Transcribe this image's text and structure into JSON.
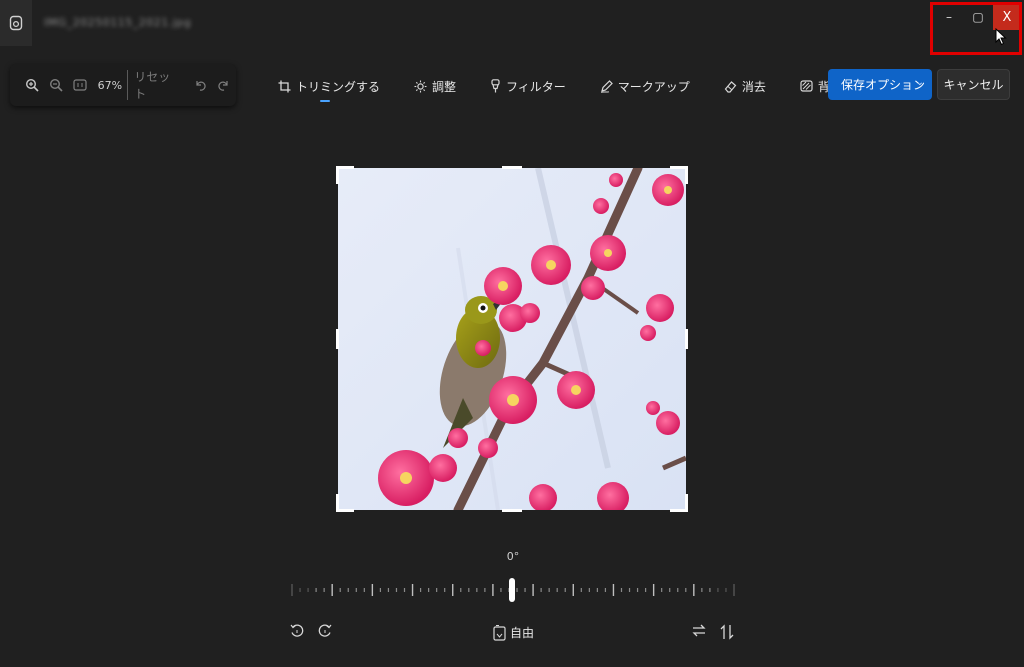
{
  "titlebar": {
    "filename": "IMG_20250115_2021.jpg",
    "minimize": "–",
    "maximize": "▢",
    "close": "X"
  },
  "zoom": {
    "value": "67%",
    "reset_label": "リセット"
  },
  "tabs": [
    {
      "label": "トリミングする",
      "icon": "crop-icon",
      "active": true
    },
    {
      "label": "調整",
      "icon": "brightness-icon",
      "active": false
    },
    {
      "label": "フィルター",
      "icon": "filter-icon",
      "active": false
    },
    {
      "label": "マークアップ",
      "icon": "markup-icon",
      "active": false
    },
    {
      "label": "消去",
      "icon": "erase-icon",
      "active": false
    },
    {
      "label": "背景",
      "icon": "background-icon",
      "active": false
    }
  ],
  "actions": {
    "save_label": "保存オプション",
    "cancel_label": "キャンセル"
  },
  "rotation": {
    "angle": "0°",
    "aspect_label": "自由"
  },
  "colors": {
    "accent": "#0f64c8",
    "close_red": "#c42b1c",
    "highlight": "#e00000",
    "background": "#202020"
  }
}
